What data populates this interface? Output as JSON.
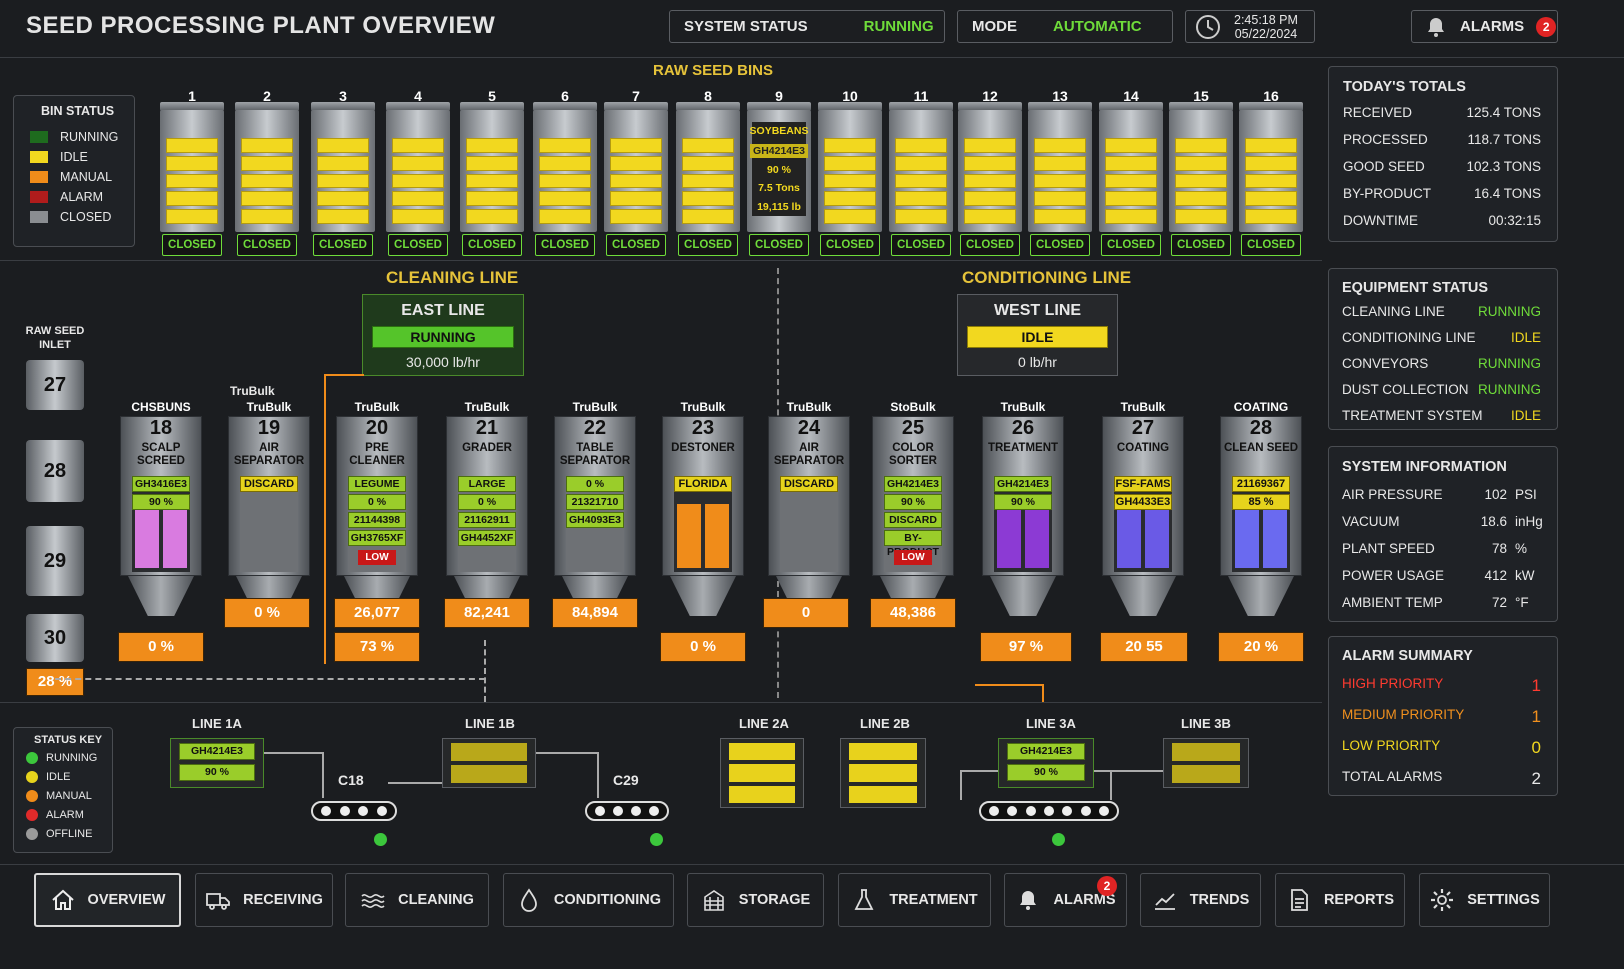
{
  "header": {
    "title": "SEED PROCESSING PLANT OVERVIEW",
    "system_status_label": "SYSTEM STATUS",
    "system_status": "RUNNING",
    "mode_label": "MODE",
    "mode": "AUTOMATIC",
    "time": "2:45:18 PM",
    "date": "05/22/2024",
    "alarms_label": "ALARMS",
    "alarms_count": "2"
  },
  "bins": {
    "title": "RAW SEED BINS",
    "numbers": [
      "1",
      "2",
      "3",
      "4",
      "5",
      "6",
      "7",
      "8",
      "9",
      "10",
      "11",
      "12",
      "13",
      "14",
      "15",
      "16"
    ],
    "status": "CLOSED",
    "bin9": {
      "crop": "SOYBEANS",
      "code": "GH4214E3",
      "pct": "90 %",
      "tons": "7.5 Tons",
      "lb": "19,115 lb"
    }
  },
  "bin_status": {
    "title": "BIN STATUS",
    "items": [
      {
        "label": "RUNNING",
        "color": "#1e6b1e"
      },
      {
        "label": "IDLE",
        "color": "#f2d81f"
      },
      {
        "label": "MANUAL",
        "color": "#f08c1a"
      },
      {
        "label": "ALARM",
        "color": "#b01c1c"
      },
      {
        "label": "CLOSED",
        "color": "#8a8d91"
      }
    ]
  },
  "totals": {
    "title": "TODAY'S TOTALS",
    "rows": [
      {
        "k": "RECEIVED",
        "v": "125.4 TONS"
      },
      {
        "k": "PROCESSED",
        "v": "118.7 TONS"
      },
      {
        "k": "GOOD SEED",
        "v": "102.3 TONS"
      },
      {
        "k": "BY-PRODUCT",
        "v": "16.4 TONS"
      },
      {
        "k": "DOWNTIME",
        "v": "00:32:15"
      }
    ]
  },
  "equipment": {
    "title": "EQUIPMENT STATUS",
    "rows": [
      {
        "k": "CLEANING LINE",
        "v": "RUNNING"
      },
      {
        "k": "CONDITIONING LINE",
        "v": "IDLE"
      },
      {
        "k": "CONVEYORS",
        "v": "RUNNING"
      },
      {
        "k": "DUST COLLECTION",
        "v": "RUNNING"
      },
      {
        "k": "TREATMENT SYSTEM",
        "v": "IDLE"
      }
    ]
  },
  "sysinfo": {
    "title": "SYSTEM INFORMATION",
    "rows": [
      {
        "k": "AIR PRESSURE",
        "v": "102",
        "u": "PSI"
      },
      {
        "k": "VACUUM",
        "v": "18.6",
        "u": "inHg"
      },
      {
        "k": "PLANT SPEED",
        "v": "78",
        "u": "%"
      },
      {
        "k": "POWER USAGE",
        "v": "412",
        "u": "kW"
      },
      {
        "k": "AMBIENT TEMP",
        "v": "72",
        "u": "°F"
      }
    ]
  },
  "alarms": {
    "title": "ALARM SUMMARY",
    "high_label": "HIGH PRIORITY",
    "high": "1",
    "medium_label": "MEDIUM PRIORITY",
    "medium": "1",
    "low_label": "LOW PRIORITY",
    "low": "0",
    "total_label": "TOTAL ALARMS",
    "total": "2"
  },
  "cleaning": {
    "title": "CLEANING LINE",
    "line": "EAST LINE",
    "status": "RUNNING",
    "rate": "30,000 lb/hr"
  },
  "conditioning": {
    "title": "CONDITIONING LINE",
    "line": "WEST LINE",
    "status": "IDLE",
    "rate": "0 lb/hr"
  },
  "inlet": {
    "label": "RAW SEED INLET",
    "silos": [
      "27",
      "28",
      "29",
      "30"
    ],
    "pct": "28 %"
  },
  "machines": [
    {
      "brand": "CHSBUNS",
      "id": "18",
      "name": "SCALP SCREED",
      "labels": [
        "GH3416E3",
        "90 %"
      ],
      "out": "0 %"
    },
    {
      "brand": "TruBulk",
      "id": "19",
      "name": "AIR SEPARATOR",
      "labels": [
        "DISCARD"
      ],
      "out": "0 %"
    },
    {
      "brand": "TruBulk",
      "id": "20",
      "name": "PRE CLEANER",
      "labels": [
        "LEGUME",
        "0 %",
        "21144398",
        "GH3765XF"
      ],
      "low": "LOW",
      "out": "26,077",
      "out2": "73 %"
    },
    {
      "brand": "TruBulk",
      "id": "21",
      "name": "GRADER",
      "labels": [
        "LARGE",
        "0 %",
        "21162911",
        "GH4452XF"
      ],
      "out": "82,241"
    },
    {
      "brand": "TruBulk",
      "id": "22",
      "name": "TABLE SEPARATOR",
      "labels": [
        "0 %",
        "21321710",
        "GH4093E3"
      ],
      "out": "84,894"
    },
    {
      "brand": "TruBulk",
      "id": "23",
      "name": "DESTONER",
      "labels": [
        "FLORIDA"
      ],
      "out": "0 %"
    },
    {
      "brand": "TruBulk",
      "id": "24",
      "name": "AIR SEPARATOR",
      "labels": [
        "DISCARD"
      ],
      "out": "0"
    },
    {
      "brand": "StoBulk",
      "id": "25",
      "name": "COLOR SORTER",
      "labels": [
        "GH4214E3",
        "90 %",
        "DISCARD",
        "BY-PRODUCT"
      ],
      "low": "LOW",
      "out": "48,386"
    },
    {
      "brand": "TruBulk",
      "id": "26",
      "name": "TREATMENT",
      "labels": [
        "GH4214E3",
        "90 %"
      ],
      "out": "97 %"
    },
    {
      "brand": "TruBulk",
      "id": "27",
      "name": "COATING",
      "labels": [
        "FSF-FAMS",
        "GH4433E3"
      ],
      "out": "20 55"
    },
    {
      "brand": "COATING",
      "id": "28",
      "name": "CLEAN SEED",
      "labels": [
        "21169367",
        "85 %"
      ],
      "out": "20 %"
    }
  ],
  "trubulk_label": "TruBulk",
  "lines": {
    "l1a": "LINE 1A",
    "l1a_code": "GH4214E3",
    "l1a_pct": "90 %",
    "l1b": "LINE 1B",
    "c18": "C18",
    "c29": "C29",
    "l2a": "LINE 2A",
    "l2b": "LINE 2B",
    "l3a": "LINE 3A",
    "l3a_code": "GH4214E3",
    "l3a_pct": "90 %",
    "l3b": "LINE 3B"
  },
  "status_key": {
    "title": "STATUS KEY",
    "items": [
      {
        "label": "RUNNING",
        "color": "#3cc73c"
      },
      {
        "label": "IDLE",
        "color": "#e6d31c"
      },
      {
        "label": "MANUAL",
        "color": "#f08c1a"
      },
      {
        "label": "ALARM",
        "color": "#e02a2a"
      },
      {
        "label": "OFFLINE",
        "color": "#9a9a9a"
      }
    ]
  },
  "nav": {
    "overview": "OVERVIEW",
    "receiving": "RECEIVING",
    "cleaning": "CLEANING",
    "conditioning": "CONDITIONING",
    "storage": "STORAGE",
    "treatment": "TREATMENT",
    "alarms": "ALARMS",
    "alarms_badge": "2",
    "trends": "TRENDS",
    "reports": "REPORTS",
    "settings": "SETTINGS"
  }
}
